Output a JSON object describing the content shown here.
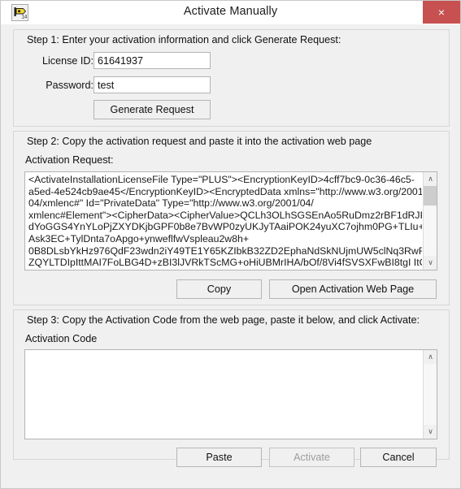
{
  "window": {
    "title": "Activate Manually",
    "icon": "labview-app-icon",
    "close_label": "×",
    "close_color": "#c75050"
  },
  "step1": {
    "heading": "Step 1: Enter your activation information and click Generate Request:",
    "license_label": "License ID:",
    "license_value": "61641937",
    "license_placeholder": "",
    "password_label": "Password:",
    "password_value": "test",
    "password_placeholder": "",
    "generate_label": "Generate Request"
  },
  "step2": {
    "heading": "Step 2: Copy the activation request and paste it into the activation web page",
    "request_label": "Activation Request:",
    "request_value": "<ActivateInstallationLicenseFile Type=\"PLUS\"><EncryptionKeyID>4cff7bc9-0c36-46c5-\na5ed-4e524cb9ae45</EncryptionKeyID><EncryptedData xmlns=\"http://www.w3.org/2001/\n04/xmlenc#\" Id=\"PrivateData\" Type=\"http://www.w3.org/2001/04/\nxmlenc#Element\"><CipherData><CipherValue>QCLh3OLhSGSEnAo5RuDmz2rBF1dRJPP9n\ndYoGGS4YnYLoPjZXYDKjbGPF0b8e7BvWP0zyUKJyTAaiPOK24yuXC7ojhm0PG+TLIu+\nAsk3EC+TylDnta7oApgo+ynweflfwVspleau2w8h+\n0B8DLsbYkHz976QdF23wdn2iY49TE1Y65KZIbkB32ZD2EphaNdSkNUjmUW5clNq3RwF/\nZQYLTDIpIttMAI7FoLBG4D+zBI3lJVRkTScMG+oHiUBMrIHA/bOf/8Vi4fSVSXFwBI8tgI ItCv+",
    "copy_label": "Copy",
    "open_web_label": "Open Activation Web Page",
    "scrollbar": {
      "up_arrow": "∧",
      "down_arrow": "∨"
    }
  },
  "step3": {
    "heading": "Step 3: Copy the Activation Code from the web page, paste it below, and click Activate:",
    "code_label": "Activation Code",
    "code_value": "",
    "code_placeholder": "",
    "paste_label": "Paste",
    "activate_label": "Activate",
    "activate_disabled": true,
    "cancel_label": "Cancel",
    "scrollbar": {
      "up_arrow": "∧",
      "down_arrow": "∨"
    }
  }
}
